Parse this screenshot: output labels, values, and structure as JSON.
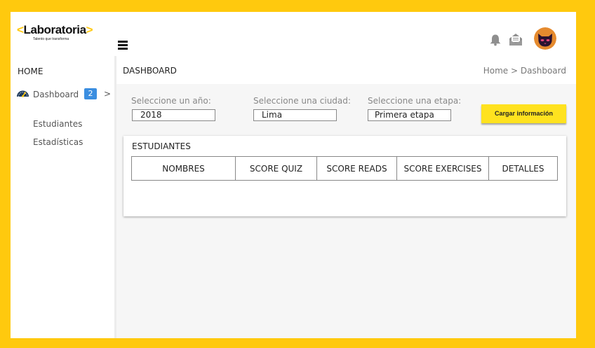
{
  "brand": {
    "name": "Laboratoria",
    "chevron_left": "<",
    "chevron_right": ">",
    "tagline": "Talento que transforma",
    "accent_color": "#ffc90e"
  },
  "topbar": {
    "menu_icon": "hamburger-icon",
    "notification_icon": "bell-icon",
    "mail_icon": "mail-icon",
    "avatar_icon": "cat-avatar"
  },
  "sidebar": {
    "home_label": "HOME",
    "dashboard": {
      "label": "Dashboard",
      "badge": "2",
      "arrow": ">",
      "icon": "speedometer-icon"
    },
    "items": [
      {
        "label": "Estudiantes"
      },
      {
        "label": "Estadísticas"
      }
    ]
  },
  "header": {
    "title": "DASHBOARD",
    "breadcrumb": {
      "home": "Home",
      "separator": ">",
      "current": "Dashboard"
    }
  },
  "filters": {
    "year": {
      "label": "Seleccione un año:",
      "value": "2018"
    },
    "city": {
      "label": "Seleccione una ciudad:",
      "value": "Lima"
    },
    "stage": {
      "label": "Seleccione una etapa:",
      "value": "Primera etapa"
    },
    "load_button": "Cargar información"
  },
  "students": {
    "title": "ESTUDIANTES",
    "columns": [
      "NOMBRES",
      "SCORE QUIZ",
      "SCORE READS",
      "SCORE EXERCISES",
      "DETALLES"
    ]
  }
}
